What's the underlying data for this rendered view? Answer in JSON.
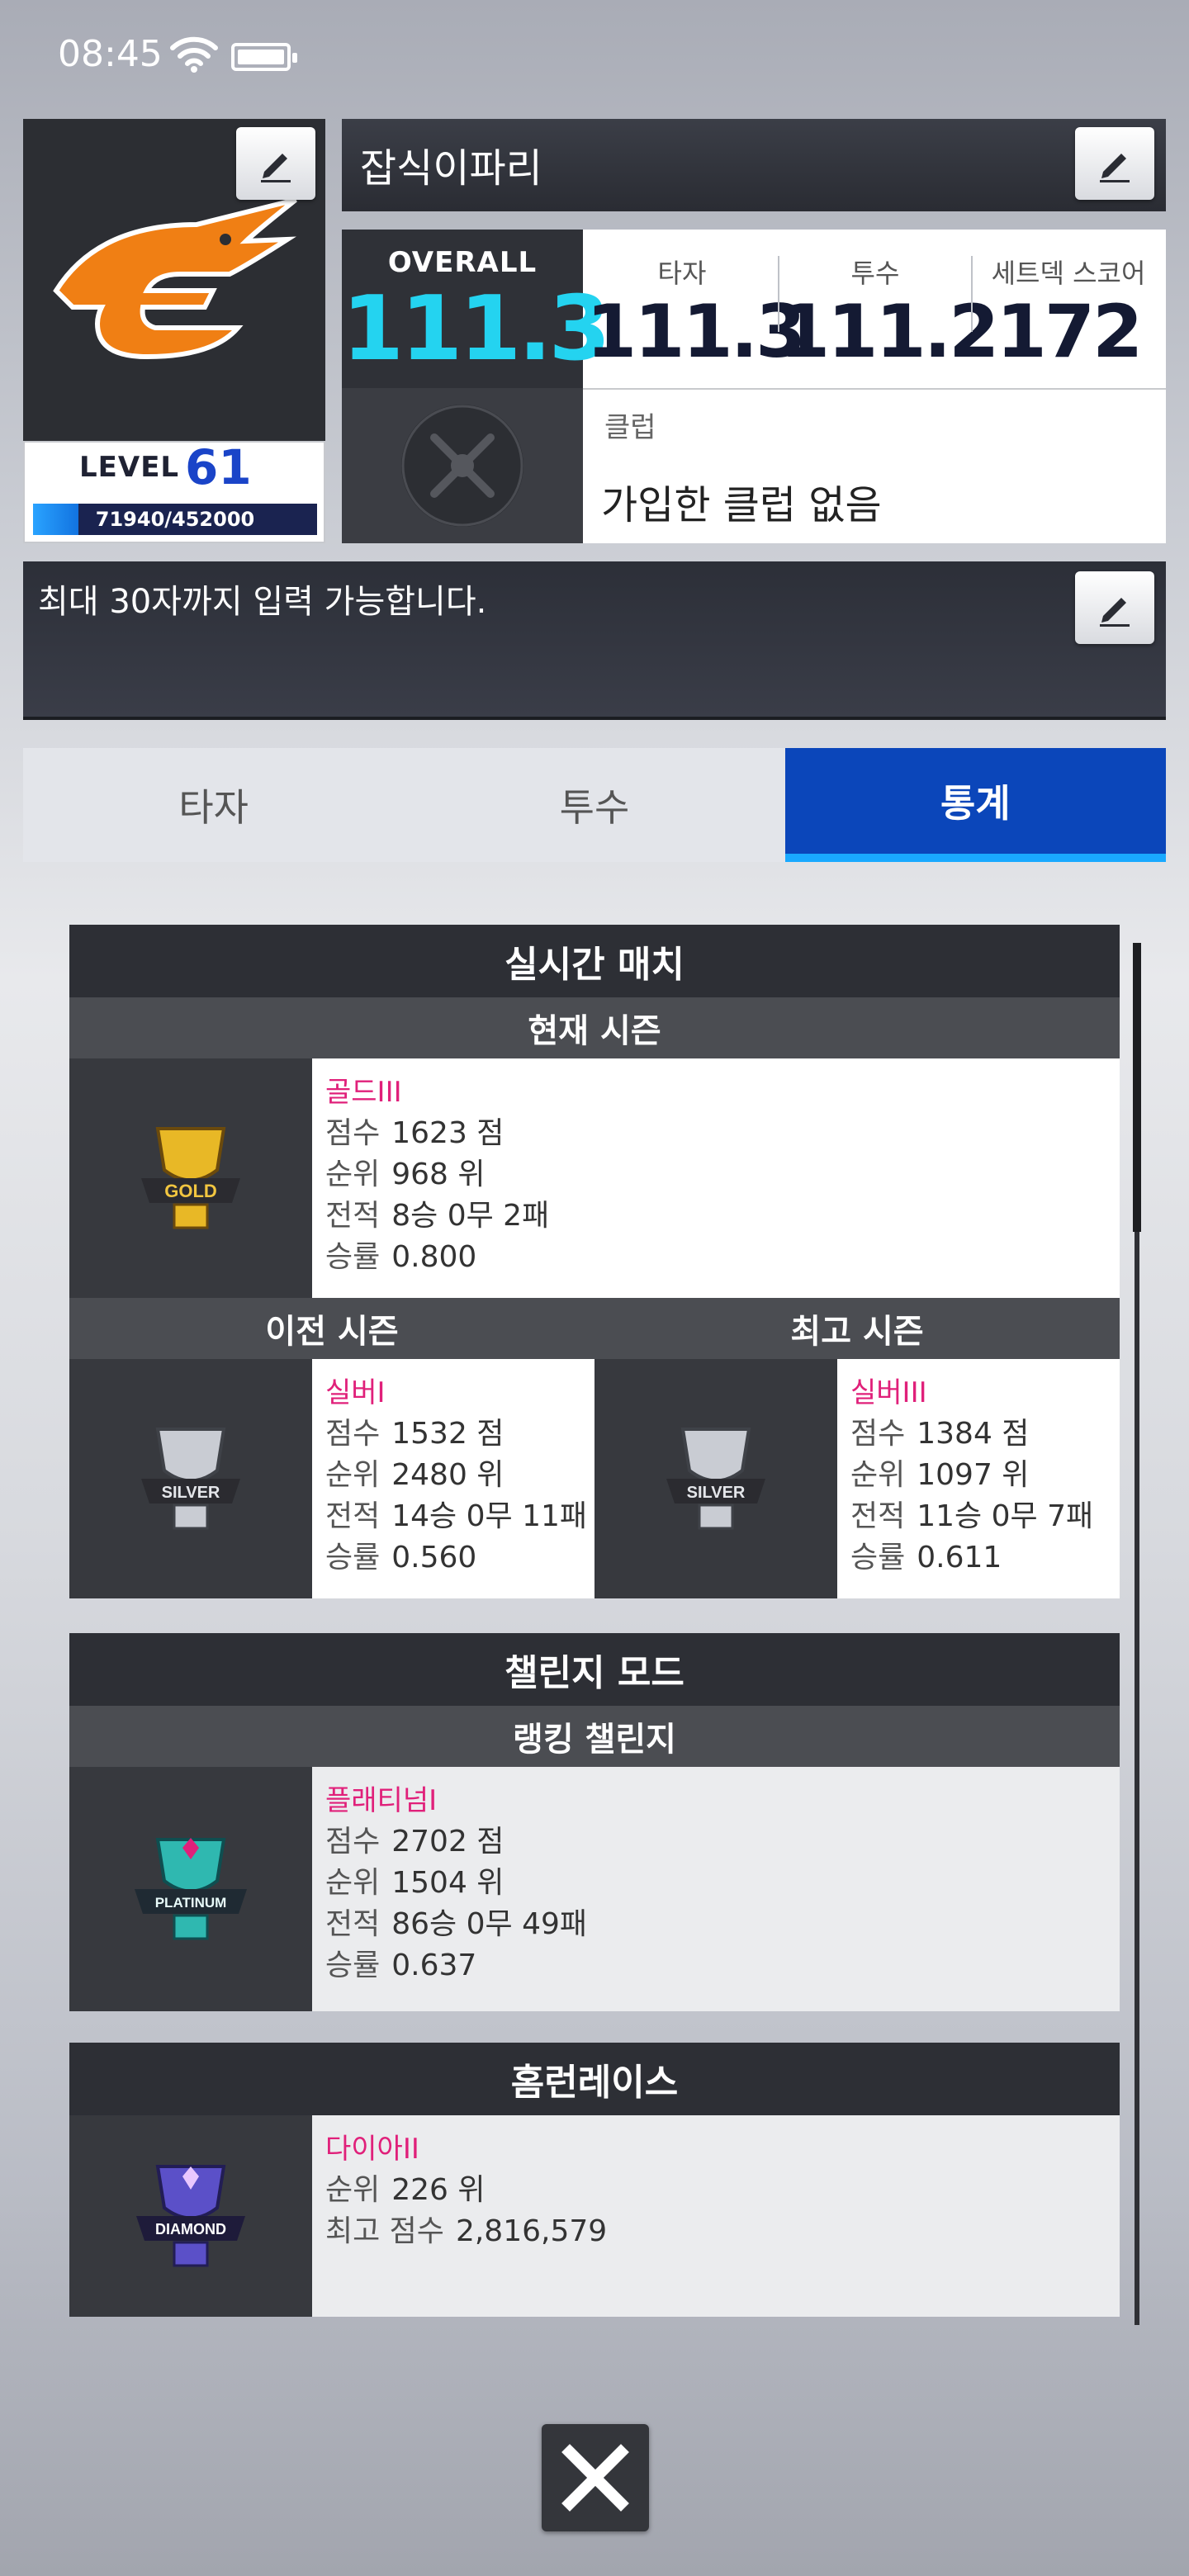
{
  "status_bar": {
    "time": "08:45"
  },
  "profile": {
    "level_label": "LEVEL",
    "level": "61",
    "xp_text": "71940/452000",
    "xp_fraction": 0.159,
    "name": "잡식이파리",
    "overall_label": "OVERALL",
    "overall": "111.3",
    "stats": [
      {
        "label": "타자",
        "value": "111.3"
      },
      {
        "label": "투수",
        "value": "111.2"
      },
      {
        "label": "세트덱 스코어",
        "value": "172"
      }
    ],
    "club_label": "클럽",
    "club_value": "가입한 클럽 없음",
    "intro_placeholder": "최대 30자까지 입력 가능합니다."
  },
  "tabs": [
    {
      "label": "타자",
      "active": false
    },
    {
      "label": "투수",
      "active": false
    },
    {
      "label": "통계",
      "active": true
    }
  ],
  "realtime": {
    "title": "실시간 매치",
    "current": {
      "title": "현재 시즌",
      "tier": "골드III",
      "badge": "gold-badge-icon",
      "score_label": "점수",
      "score": "1623 점",
      "rank_label": "순위",
      "rank": "968 위",
      "record_label": "전적",
      "record": "8승 0무 2패",
      "winrate_label": "승률",
      "winrate": "0.800"
    },
    "previous": {
      "title": "이전 시즌",
      "tier": "실버I",
      "badge": "silver-badge-icon",
      "score_label": "점수",
      "score": "1532 점",
      "rank_label": "순위",
      "rank": "2480 위",
      "record_label": "전적",
      "record": "14승 0무 11패",
      "winrate_label": "승률",
      "winrate": "0.560"
    },
    "best": {
      "title": "최고 시즌",
      "tier": "실버III",
      "badge": "silver-badge-icon",
      "score_label": "점수",
      "score": "1384 점",
      "rank_label": "순위",
      "rank": "1097 위",
      "record_label": "전적",
      "record": "11승 0무 7패",
      "winrate_label": "승률",
      "winrate": "0.611"
    }
  },
  "challenge": {
    "title": "챌린지 모드",
    "ranking": {
      "title": "랭킹 챌린지",
      "tier": "플래티넘I",
      "badge": "platinum-badge-icon",
      "score_label": "점수",
      "score": "2702 점",
      "rank_label": "순위",
      "rank": "1504 위",
      "record_label": "전적",
      "record": "86승 0무 49패",
      "winrate_label": "승률",
      "winrate": "0.637"
    }
  },
  "homerun": {
    "title": "홈런레이스",
    "tier": "다이아II",
    "badge": "diamond-badge-icon",
    "rank_label": "순위",
    "rank": "226 위",
    "best_label": "최고 점수",
    "best": "2,816,579"
  },
  "badge_text": {
    "gold": "GOLD",
    "silver": "SILVER",
    "platinum": "PLATINUM",
    "diamond": "DIAMOND"
  },
  "colors": {
    "accent": "#0b46ba",
    "overall": "#24d3f0",
    "tier": "#e0207a"
  }
}
